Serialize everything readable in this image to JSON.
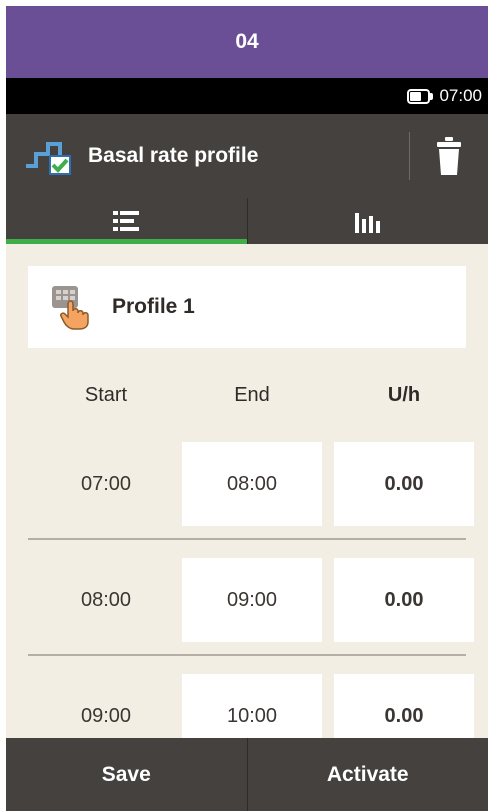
{
  "step": {
    "number": "04"
  },
  "status": {
    "time": "07:00",
    "battery_icon": "battery-icon"
  },
  "header": {
    "title": "Basal rate profile",
    "icon": "basal-profile-icon",
    "delete_icon": "trash-icon"
  },
  "tabs": [
    {
      "icon": "list-view-icon",
      "active": true
    },
    {
      "icon": "bar-chart-icon",
      "active": false
    }
  ],
  "profile": {
    "name": "Profile 1",
    "icon": "hand-select-icon"
  },
  "table": {
    "headers": {
      "start": "Start",
      "end": "End",
      "rate": "U/h"
    },
    "rows": [
      {
        "start": "07:00",
        "end": "08:00",
        "rate": "0.00"
      },
      {
        "start": "08:00",
        "end": "09:00",
        "rate": "0.00"
      },
      {
        "start": "09:00",
        "end": "10:00",
        "rate": "0.00"
      }
    ]
  },
  "footer": {
    "save_label": "Save",
    "activate_label": "Activate"
  },
  "colors": {
    "banner": "#6b4f96",
    "bar": "#45413f",
    "accent": "#3fae48",
    "background": "#f3eee4"
  }
}
